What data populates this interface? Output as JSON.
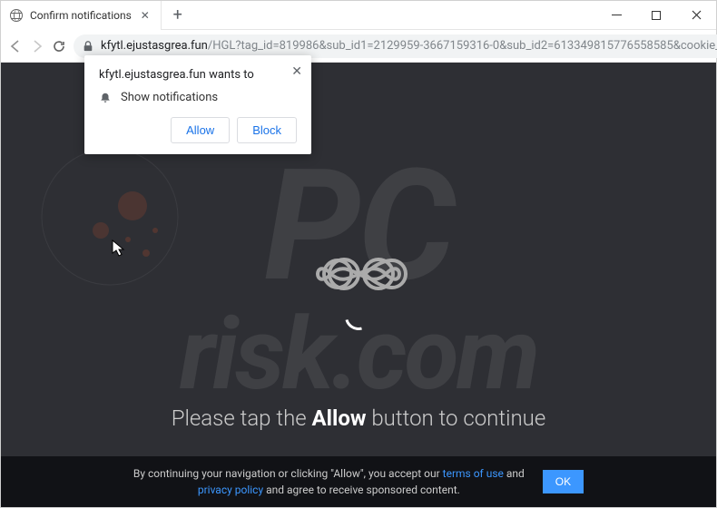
{
  "tab": {
    "title": "Confirm notifications"
  },
  "url": {
    "domain": "kfytl.ejustasgrea.fun",
    "path": "/HGL?tag_id=819986&sub_id1=2129959-3667159316-0&sub_id2=613349815776558585&cookie_id..."
  },
  "permission": {
    "prompt": "kfytl.ejustasgrea.fun wants to",
    "permission_name": "Show notifications",
    "allow_label": "Allow",
    "block_label": "Block"
  },
  "page": {
    "main_text_pre": "Please tap the ",
    "main_text_bold": "Allow",
    "main_text_post": " button to continue"
  },
  "cookie": {
    "line1_a": "By continuing your navigation or clicking \"Allow\", you accept our ",
    "terms_link": "terms of use",
    "line1_b": " and",
    "line2_a": "",
    "privacy_link": "privacy policy",
    "line2_b": " and agree to receive sponsored content.",
    "ok_label": "OK"
  },
  "watermark": {
    "pc": "PC",
    "risk": "risk.com"
  }
}
